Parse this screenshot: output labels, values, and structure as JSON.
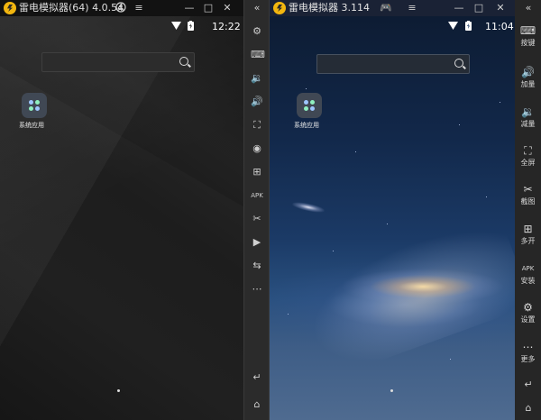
{
  "left_window": {
    "title": "雷电模拟器(64) 4.0.54",
    "clock": "12:22",
    "app_label": "系统应用"
  },
  "right_window": {
    "title": "雷电模拟器 3.114",
    "clock": "11:04",
    "app_label": "系统应用"
  },
  "middle_toolbar": {
    "icons": [
      "collapse-icon",
      "settings-gear-icon",
      "keyboard-icon",
      "volume-down-icon",
      "volume-up-icon",
      "fullscreen-icon",
      "record-icon",
      "multi-open-icon",
      "apk-icon",
      "screenshot-icon",
      "video-icon",
      "sync-icon",
      "more-icon",
      "back-icon",
      "home-icon"
    ]
  },
  "right_sidebar": {
    "items": [
      {
        "label": "按键",
        "icon": "keyboard-icon"
      },
      {
        "label": "加量",
        "icon": "volume-up-icon"
      },
      {
        "label": "减量",
        "icon": "volume-down-icon"
      },
      {
        "label": "全屏",
        "icon": "fullscreen-icon"
      },
      {
        "label": "截图",
        "icon": "scissors-icon"
      },
      {
        "label": "多开",
        "icon": "multi-open-icon"
      },
      {
        "label": "安装",
        "icon": "apk-icon"
      },
      {
        "label": "设置",
        "icon": "gear-icon"
      },
      {
        "label": "更多",
        "icon": "more-icon"
      }
    ]
  },
  "colors": {
    "logo": "#f2b60f",
    "toolbar_bg": "#2b2b2b",
    "left_bg": "#1b1b1b",
    "right_sky": "#1b3a66"
  }
}
